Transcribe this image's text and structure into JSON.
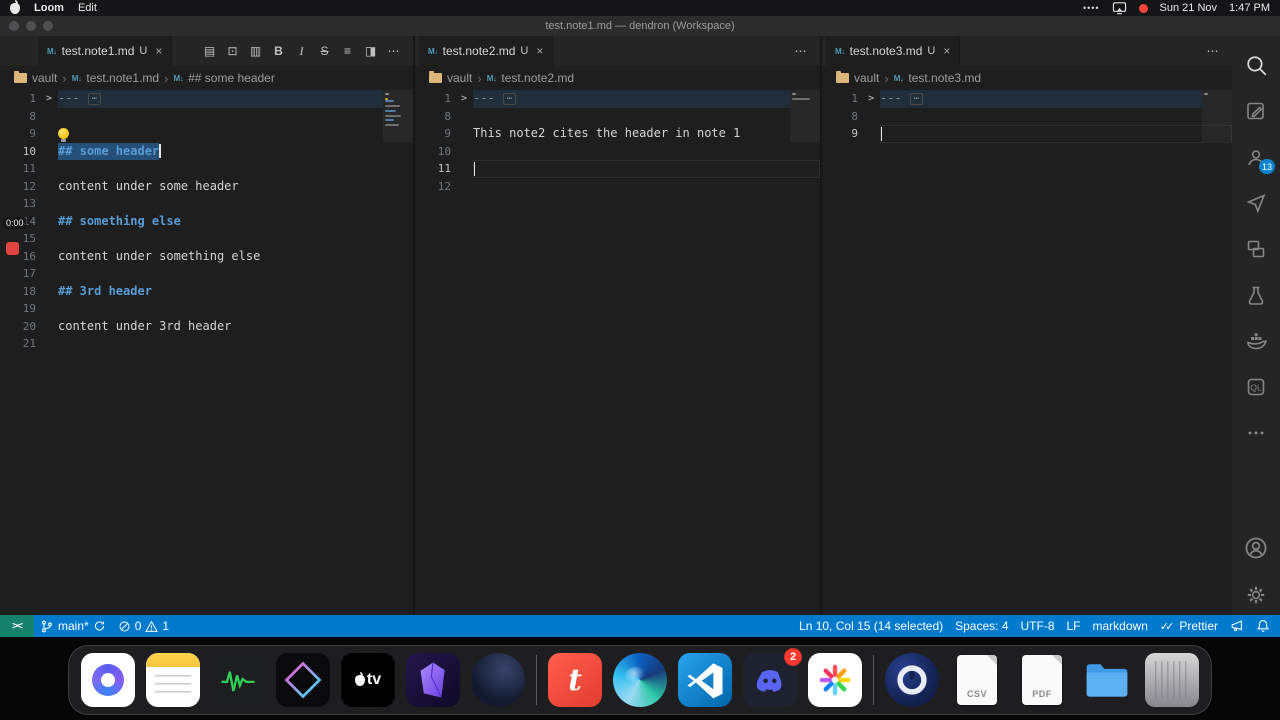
{
  "menubar": {
    "app_name": "Loom",
    "menus": [
      "Edit"
    ],
    "clock_date": "Sun 21 Nov",
    "clock_time": "1:47 PM"
  },
  "window": {
    "title": "test.note1.md — dendron (Workspace)"
  },
  "loom_recorder": {
    "time": "0:00"
  },
  "editor_toolbar": [
    {
      "name": "open-preview-icon",
      "glyph": "▤"
    },
    {
      "name": "copy-icon",
      "glyph": "⊡"
    },
    {
      "name": "open-preview-side-icon",
      "glyph": "▥"
    },
    {
      "name": "bold-icon",
      "glyph": "B"
    },
    {
      "name": "italic-icon",
      "glyph": "I"
    },
    {
      "name": "strikethrough-icon",
      "glyph": "S"
    },
    {
      "name": "bullet-list-icon",
      "glyph": "≡"
    },
    {
      "name": "split-editor-icon",
      "glyph": "◨"
    },
    {
      "name": "more-actions-icon",
      "glyph": "⋯"
    }
  ],
  "panes": [
    {
      "tab": {
        "label": "test.note1.md",
        "badge": "U"
      },
      "breadcrumb": [
        "vault",
        "test.note1.md",
        "## some header"
      ],
      "lines": [
        {
          "n": 1,
          "k": "fold",
          "t": "---"
        },
        {
          "n": 8,
          "k": "blank",
          "t": ""
        },
        {
          "n": 9,
          "k": "emoji",
          "t": "💡"
        },
        {
          "n": 10,
          "k": "h",
          "t": "## some header",
          "sel": true,
          "cur": true,
          "caret": true
        },
        {
          "n": 11,
          "k": "blank",
          "t": ""
        },
        {
          "n": 12,
          "k": "p",
          "t": "content under some header"
        },
        {
          "n": 13,
          "k": "blank",
          "t": ""
        },
        {
          "n": 14,
          "k": "h",
          "t": "## something else"
        },
        {
          "n": 15,
          "k": "blank",
          "t": ""
        },
        {
          "n": 16,
          "k": "p",
          "t": "content under something else"
        },
        {
          "n": 17,
          "k": "blank",
          "t": ""
        },
        {
          "n": 18,
          "k": "h",
          "t": "## 3rd header"
        },
        {
          "n": 19,
          "k": "blank",
          "t": ""
        },
        {
          "n": 20,
          "k": "p",
          "t": "content under 3rd header"
        },
        {
          "n": 21,
          "k": "blank",
          "t": ""
        }
      ]
    },
    {
      "tab": {
        "label": "test.note2.md",
        "badge": "U"
      },
      "breadcrumb": [
        "vault",
        "test.note2.md"
      ],
      "lines": [
        {
          "n": 1,
          "k": "fold",
          "t": "---"
        },
        {
          "n": 8,
          "k": "blank",
          "t": ""
        },
        {
          "n": 9,
          "k": "p",
          "t": "This note2 cites the header in note 1"
        },
        {
          "n": 10,
          "k": "blank",
          "t": ""
        },
        {
          "n": 11,
          "k": "blank",
          "t": "",
          "cur": true,
          "caret": true,
          "box": true
        },
        {
          "n": 12,
          "k": "blank",
          "t": ""
        }
      ]
    },
    {
      "tab": {
        "label": "test.note3.md",
        "badge": "U"
      },
      "breadcrumb": [
        "vault",
        "test.note3.md"
      ],
      "lines": [
        {
          "n": 1,
          "k": "fold",
          "t": "---"
        },
        {
          "n": 8,
          "k": "blank",
          "t": ""
        },
        {
          "n": 9,
          "k": "blank",
          "t": "",
          "cur": true,
          "caret": true,
          "box": true
        }
      ]
    }
  ],
  "activity_bar": {
    "badge": "13",
    "items": [
      "search",
      "note-edit",
      "accounts",
      "send",
      "layouts",
      "beaker",
      "docker",
      "codeql",
      "more",
      "account",
      "settings"
    ],
    "codeql_label": "QL"
  },
  "statusbar": {
    "remote": "><",
    "branch": "main*",
    "errors": "0",
    "warnings": "1",
    "selection": "Ln 10, Col 15 (14 selected)",
    "indent": "Spaces: 4",
    "encoding": "UTF-8",
    "eol": "LF",
    "language": "markdown",
    "formatter": "Prettier"
  },
  "dock": {
    "items": [
      {
        "name": "loom"
      },
      {
        "name": "notes"
      },
      {
        "name": "audio-recorder"
      },
      {
        "name": "prism"
      },
      {
        "name": "apple-tv",
        "label": "tv"
      },
      {
        "name": "obsidian"
      },
      {
        "name": "dark-app"
      },
      {
        "name": "separator"
      },
      {
        "name": "timer",
        "label": "t"
      },
      {
        "name": "edge"
      },
      {
        "name": "vscode"
      },
      {
        "name": "discord",
        "badge": "2"
      },
      {
        "name": "pinwheel"
      },
      {
        "name": "separator"
      },
      {
        "name": "onepassword"
      },
      {
        "name": "csv-file",
        "label": "CSV"
      },
      {
        "name": "pdf-file",
        "label": "PDF"
      },
      {
        "name": "downloads-folder"
      },
      {
        "name": "trash"
      }
    ]
  }
}
